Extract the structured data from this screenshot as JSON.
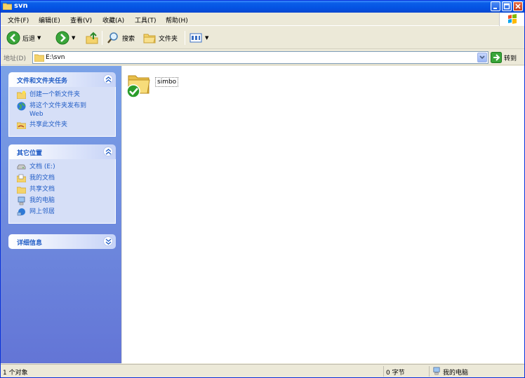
{
  "window": {
    "title": "svn",
    "controls": [
      "minimize",
      "maximize",
      "close"
    ]
  },
  "menu": {
    "items": [
      "文件(F)",
      "编辑(E)",
      "查看(V)",
      "收藏(A)",
      "工具(T)",
      "帮助(H)"
    ]
  },
  "toolbar": {
    "back_label": "后退",
    "search_label": "搜索",
    "folders_label": "文件夹"
  },
  "address": {
    "label": "地址(D)",
    "value": "E:\\svn",
    "go_label": "转到"
  },
  "sidebar": {
    "tasks": {
      "title": "文件和文件夹任务",
      "items": [
        "创建一个新文件夹",
        "将这个文件夹发布到 Web",
        "共享此文件夹"
      ]
    },
    "places": {
      "title": "其它位置",
      "items": [
        "文档 (E:)",
        "我的文档",
        "共享文档",
        "我的电脑",
        "网上邻居"
      ]
    },
    "details": {
      "title": "详细信息"
    }
  },
  "content": {
    "items": [
      {
        "name": "simbo",
        "type": "folder",
        "status": "svn-normal"
      }
    ]
  },
  "status": {
    "objects": "1 个对象",
    "size": "0 字节",
    "location": "我的电脑"
  },
  "colors": {
    "titlebar": "#0453e3",
    "sidebar_top": "#7ba2e7",
    "sidebar_bottom": "#6375d6",
    "panel_title": "#215dc6",
    "link": "#215dc6"
  }
}
